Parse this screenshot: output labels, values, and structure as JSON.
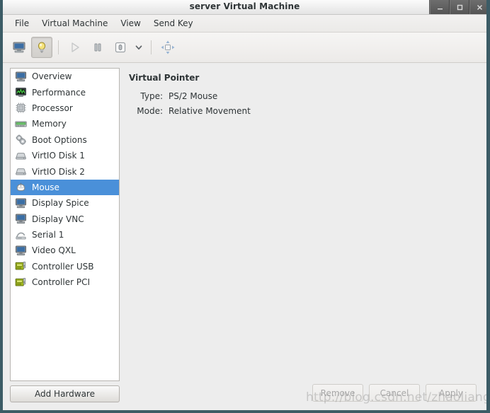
{
  "window": {
    "title": "server Virtual Machine",
    "controls": [
      {
        "name": "minimize",
        "glyph": "_"
      },
      {
        "name": "maximize",
        "glyph": "□"
      },
      {
        "name": "close",
        "glyph": "✕"
      }
    ]
  },
  "menubar": {
    "items": [
      {
        "label": "File"
      },
      {
        "label": "Virtual Machine"
      },
      {
        "label": "View"
      },
      {
        "label": "Send Key"
      }
    ]
  },
  "toolbar": {
    "items": [
      {
        "icon": "monitor-console-icon",
        "label": "Show the graphical console",
        "state": "normal"
      },
      {
        "icon": "lightbulb-details-icon",
        "label": "Show virtual hardware details",
        "state": "active"
      },
      {
        "icon": "separator",
        "label": ""
      },
      {
        "icon": "play-run-icon",
        "label": "Run",
        "state": "disabled"
      },
      {
        "icon": "pause-icon",
        "label": "Pause",
        "state": "normal"
      },
      {
        "icon": "shutdown-power-icon",
        "label": "Shut Down",
        "state": "normal"
      },
      {
        "icon": "chevron-down-icon",
        "label": "Shutdown options",
        "state": "normal"
      },
      {
        "icon": "separator",
        "label": ""
      },
      {
        "icon": "fullscreen-icon",
        "label": "Fullscreen",
        "state": "normal"
      }
    ]
  },
  "sidebar": {
    "items": [
      {
        "label": "Overview",
        "icon": "monitor-icon",
        "selected": false
      },
      {
        "label": "Performance",
        "icon": "performance-icon",
        "selected": false
      },
      {
        "label": "Processor",
        "icon": "cpu-chip-icon",
        "selected": false
      },
      {
        "label": "Memory",
        "icon": "memory-icon",
        "selected": false
      },
      {
        "label": "Boot Options",
        "icon": "gears-icon",
        "selected": false
      },
      {
        "label": "VirtIO Disk 1",
        "icon": "disk-icon",
        "selected": false
      },
      {
        "label": "VirtIO Disk 2",
        "icon": "disk-icon",
        "selected": false
      },
      {
        "label": "Mouse",
        "icon": "mouse-icon",
        "selected": true
      },
      {
        "label": "Display Spice",
        "icon": "monitor-icon",
        "selected": false
      },
      {
        "label": "Display VNC",
        "icon": "monitor-icon",
        "selected": false
      },
      {
        "label": "Serial 1",
        "icon": "serial-icon",
        "selected": false
      },
      {
        "label": "Video QXL",
        "icon": "monitor-icon",
        "selected": false
      },
      {
        "label": "Controller USB",
        "icon": "controller-icon",
        "selected": false
      },
      {
        "label": "Controller PCI",
        "icon": "controller-icon",
        "selected": false
      }
    ],
    "add_hardware_label": "Add Hardware"
  },
  "detail": {
    "title": "Virtual Pointer",
    "fields": [
      {
        "label": "Type:",
        "value": "PS/2 Mouse"
      },
      {
        "label": "Mode:",
        "value": "Relative Movement"
      }
    ]
  },
  "actions": {
    "buttons": [
      {
        "label": "Remove",
        "enabled": false
      },
      {
        "label": "Cancel",
        "enabled": false
      },
      {
        "label": "Apply",
        "enabled": false
      }
    ]
  },
  "watermark": {
    "text": "http://blog.csdn.net/zhaoliangGuo"
  },
  "colors": {
    "selection_blue": "#4a90d9",
    "window_frame": "#3c5c66",
    "chrome_bg": "#ededed",
    "text": "#2e3436"
  }
}
